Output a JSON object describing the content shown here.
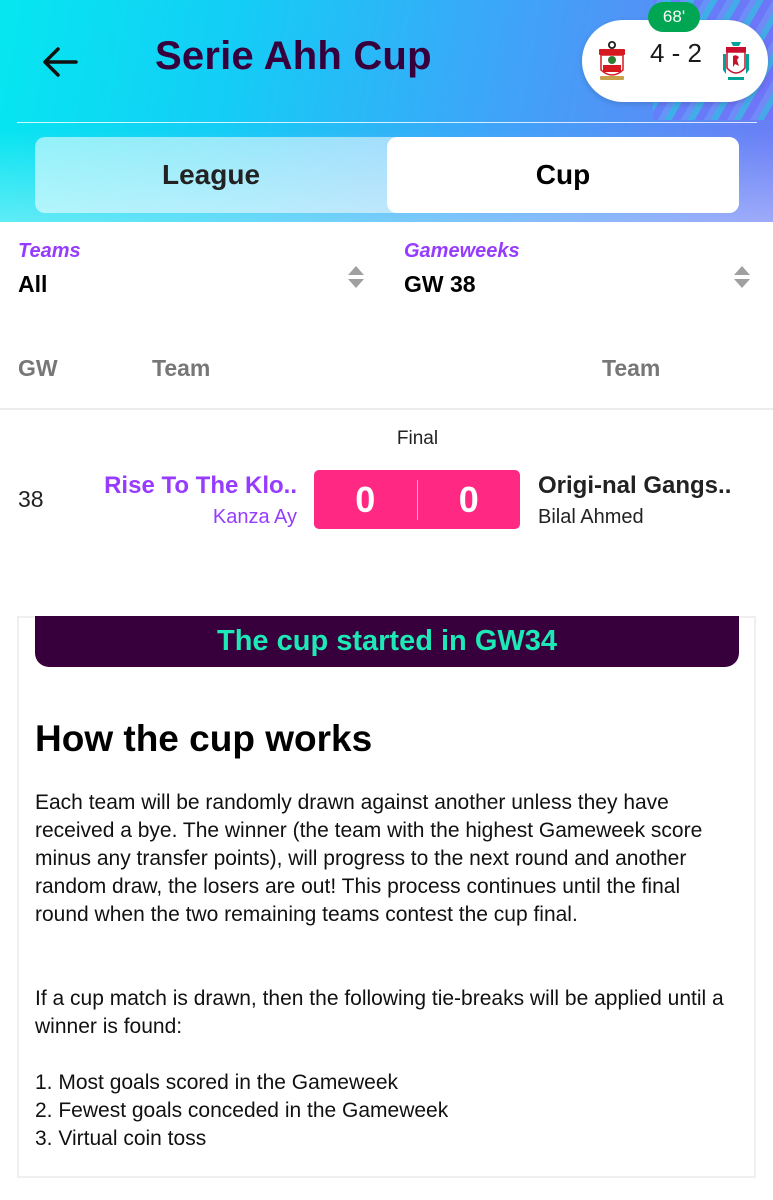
{
  "header": {
    "title": "Serie Ahh Cup",
    "back_icon": "arrow-left-icon"
  },
  "live_match": {
    "minute": "68'",
    "score": "4 - 2",
    "home_crest": "southampton-crest-icon",
    "away_crest": "liverpool-crest-icon"
  },
  "tabs": [
    {
      "label": "League",
      "active": false
    },
    {
      "label": "Cup",
      "active": true
    }
  ],
  "filters": {
    "teams": {
      "label": "Teams",
      "value": "All"
    },
    "gameweeks": {
      "label": "Gameweeks",
      "value": "GW 38"
    }
  },
  "table": {
    "headers": {
      "gw": "GW",
      "team1": "Team",
      "team2": "Team"
    },
    "matches": [
      {
        "status": "Final",
        "gw": "38",
        "home_team": "Rise To The Klo..",
        "home_manager": "Kanza Ay",
        "home_score": "0",
        "away_score": "0",
        "away_team": "Origi-nal Gangs..",
        "away_manager": "Bilal Ahmed"
      }
    ]
  },
  "info": {
    "banner": "The cup started in GW34",
    "title": "How the cup works",
    "paragraph1": "Each team will be randomly drawn against another unless they have received a bye. The winner (the team with the highest Gameweek score minus any transfer points), will progress to the next round and another random draw, the losers are out! This process continues until the final round when the two remaining teams contest the cup final.",
    "paragraph2": "If a cup match is drawn, then the following tie-breaks will be applied until a winner is found:",
    "rules": [
      "1. Most goals scored in the Gameweek",
      "2. Fewest goals conceded in the Gameweek",
      "3. Virtual coin toss"
    ]
  },
  "colors": {
    "brand_purple": "#37003c",
    "accent_purple": "#963cff",
    "score_pink": "#ff2882",
    "banner_text_green": "#1de9b6",
    "live_green": "#00a651"
  }
}
